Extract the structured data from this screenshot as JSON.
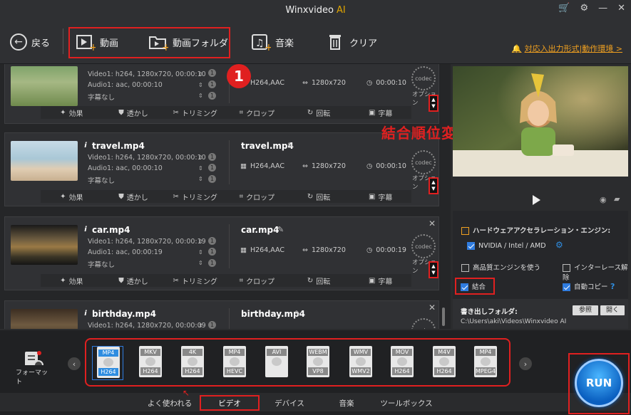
{
  "app": {
    "title": "Winxvideo",
    "title_ai": "AI"
  },
  "toolbar": {
    "back_label": "戻る",
    "add_video_label": "動画",
    "add_folder_label": "動画フォルダ",
    "add_music_label": "音楽",
    "clear_label": "クリア",
    "support_link": "対応入出力形式|動作環境 >"
  },
  "annotations": {
    "step_number": "1",
    "reorder_label": "結合順位変更"
  },
  "files": [
    {
      "name": "",
      "video_info": "Video1: h264, 1280x720, 00:00:10",
      "audio_info": "Audio1: aac, 00:00:10",
      "subtitle_info": "字幕なし",
      "track_count": "1",
      "output_name": "",
      "out_codec": "H264,AAC",
      "out_resolution": "1280x720",
      "out_duration": "00:00:10"
    },
    {
      "name": "travel.mp4",
      "video_info": "Video1: h264, 1280x720, 00:00:10",
      "audio_info": "Audio1: aac, 00:00:10",
      "subtitle_info": "字幕なし",
      "track_count": "1",
      "output_name": "travel.mp4",
      "out_codec": "H264,AAC",
      "out_resolution": "1280x720",
      "out_duration": "00:00:10"
    },
    {
      "name": "car.mp4",
      "video_info": "Video1: h264, 1280x720, 00:00:19",
      "audio_info": "Audio1: aac, 00:00:19",
      "subtitle_info": "字幕なし",
      "track_count": "1",
      "output_name": "car.mp4",
      "out_codec": "H264,AAC",
      "out_resolution": "1280x720",
      "out_duration": "00:00:19"
    },
    {
      "name": "birthday.mp4",
      "video_info": "Video1: h264, 1280x720, 00:00:09",
      "audio_info": "",
      "subtitle_info": "",
      "track_count": "1",
      "output_name": "birthday.mp4",
      "out_codec": "",
      "out_resolution": "",
      "out_duration": ""
    }
  ],
  "item_actions": {
    "effect": "効果",
    "watermark": "透かし",
    "trim": "トリミング",
    "crop": "クロップ",
    "rotate": "回転",
    "subtitle": "字幕"
  },
  "codec": {
    "badge": "codec",
    "option_label": "オプション"
  },
  "right_panel": {
    "hw_accel_label": "ハードウェアアクセラレーション・エンジン:",
    "hw_option": "NVIDIA / Intel / AMD",
    "hq_engine": "高品質エンジンを使う",
    "deinterlace": "インターレース解除",
    "merge": "結合",
    "auto_copy": "自動コピー",
    "output_folder_label": "書き出しフォルダ:",
    "output_path": "C:\\Users\\aki\\Videos\\Winxvideo AI",
    "browse_btn": "参照",
    "open_btn": "開く"
  },
  "bottom": {
    "format_label": "フォーマット",
    "formats": [
      {
        "top": "MP4",
        "bottom": "H264",
        "selected": true
      },
      {
        "top": "MKV",
        "bottom": "H264"
      },
      {
        "top": "4K",
        "bottom": "H264"
      },
      {
        "top": "MP4",
        "bottom": "HEVC"
      },
      {
        "top": "AVI",
        "bottom": ""
      },
      {
        "top": "WEBM",
        "bottom": "VP8"
      },
      {
        "top": "WMV",
        "bottom": "WMV2"
      },
      {
        "top": "MOV",
        "bottom": "H264"
      },
      {
        "top": "M4V",
        "bottom": "H264"
      },
      {
        "top": "MP4",
        "bottom": "MPEG4"
      }
    ],
    "tabs": [
      "よく使われる",
      "ビデオ",
      "デバイス",
      "音楽",
      "ツールボックス"
    ],
    "run_label": "RUN"
  }
}
